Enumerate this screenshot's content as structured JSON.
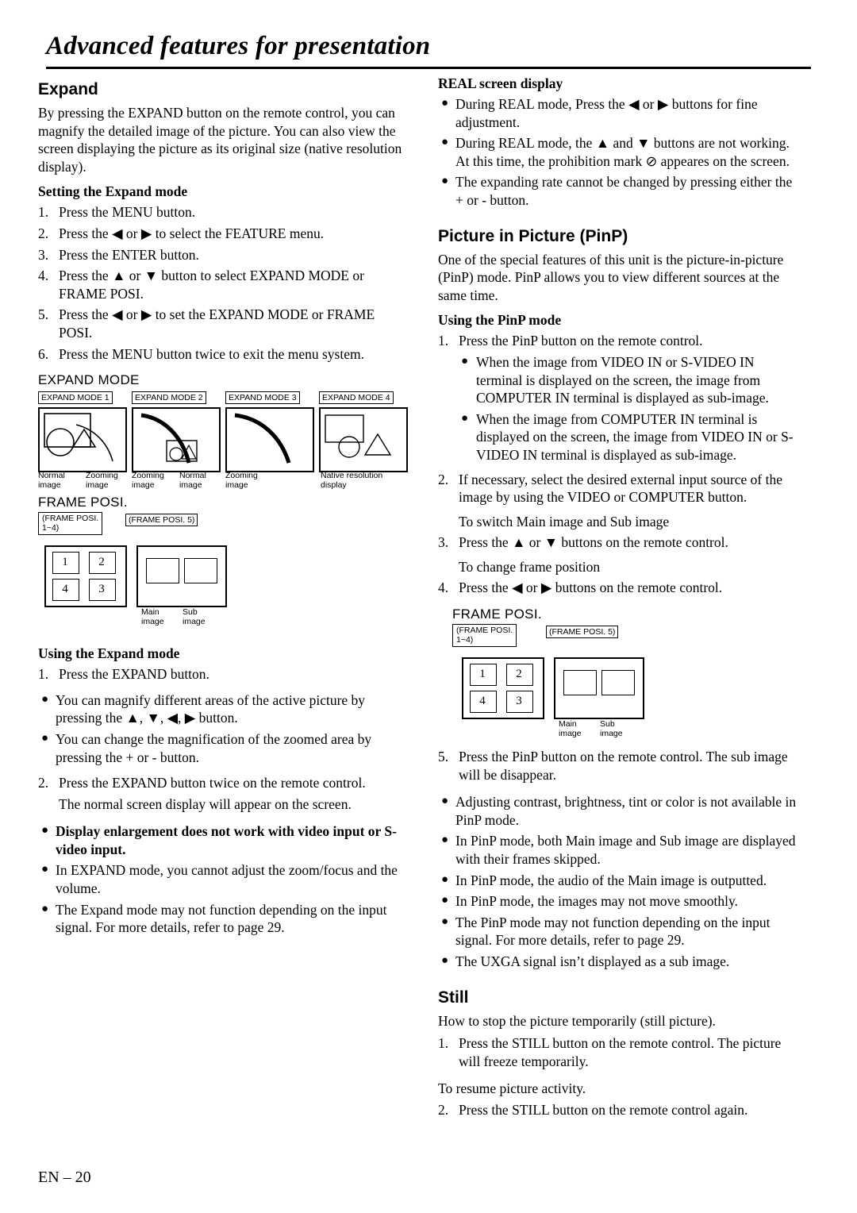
{
  "page": {
    "title": "Advanced features for presentation",
    "footer": "EN – 20"
  },
  "left": {
    "expand": {
      "heading": "Expand",
      "intro": "By pressing the EXPAND button on the remote control, you can magnify the detailed image of the picture. You can also view the screen displaying the picture as its original size (native resolution display).",
      "setting_heading": "Setting the Expand mode",
      "steps": [
        {
          "num": "1.",
          "text": "Press the MENU button."
        },
        {
          "num": "2.",
          "text": "Press the ◀ or ▶ to select the FEATURE menu."
        },
        {
          "num": "3.",
          "text": "Press the ENTER button."
        },
        {
          "num": "4.",
          "text": "Press the ▲ or ▼ button to select EXPAND MODE or FRAME POSI."
        },
        {
          "num": "5.",
          "text": "Press the ◀ or ▶ to set the EXPAND MODE or FRAME POSI."
        },
        {
          "num": "6.",
          "text": "Press the MENU button twice to exit the menu system."
        }
      ],
      "expand_mode_label": "EXPAND MODE",
      "expand_mode_cells": [
        {
          "label": "EXPAND MODE 1",
          "caption_left": "Normal\nimage",
          "caption_right": "Zooming\nimage"
        },
        {
          "label": "EXPAND MODE 2",
          "caption_left": "Zooming\nimage",
          "caption_right": "Normal\nimage"
        },
        {
          "label": "EXPAND MODE 3",
          "caption_left": "Zooming\nimage",
          "caption_right": ""
        },
        {
          "label": "EXPAND MODE 4",
          "caption_left": "Native resolution\ndisplay",
          "caption_right": ""
        }
      ],
      "frame_posi_label": "FRAME POSI.",
      "frame_posi_box1": "FRAME POSI.\n1~4)",
      "frame_posi_box1_open": "(FRAME POSI.",
      "frame_posi_box1_range": "1~4)",
      "frame_posi_box2": "(FRAME POSI. 5)",
      "frame_quadrants": [
        "1",
        "2",
        "4",
        "3"
      ],
      "main_caption": "Main\nimage",
      "sub_caption": "Sub\nimage",
      "using_heading": "Using the Expand mode",
      "using_steps": [
        {
          "type": "num",
          "num": "1.",
          "text": "Press the EXPAND button."
        },
        {
          "type": "bullet",
          "text": "You can magnify different areas of the active picture by pressing the ▲, ▼, ◀, ▶ button."
        },
        {
          "type": "bullet",
          "text": "You can change the magnification of the zoomed area by pressing the + or - button."
        },
        {
          "type": "num",
          "num": "2.",
          "text": "Press the EXPAND button twice on the remote control."
        },
        {
          "type": "plain",
          "text": "The normal screen display will appear on the screen."
        }
      ],
      "notes": [
        {
          "bold": true,
          "text": "Display enlargement does not work with video input or S-video input."
        },
        {
          "bold": false,
          "text": "In EXPAND mode, you cannot adjust the zoom/focus and the volume."
        },
        {
          "bold": false,
          "text": "The Expand mode may not function depending on the input signal. For more details, refer to page 29."
        }
      ]
    }
  },
  "right": {
    "real": {
      "heading": "REAL screen display",
      "bullets": [
        "During REAL mode, Press the ◀ or ▶ buttons for fine adjustment.",
        "During REAL mode, the ▲ and ▼ buttons are not working. At this time, the prohibition mark ⊘ appeares on the screen.",
        "The expanding rate cannot be changed by pressing either the + or - button."
      ]
    },
    "pinp": {
      "heading": "Picture in Picture (PinP)",
      "intro": "One of the special features of this unit is the picture-in-picture (PinP) mode. PinP allows you to view different sources at the same time.",
      "using_heading": "Using the PinP mode",
      "items": [
        {
          "type": "num",
          "num": "1.",
          "text": "Press the PinP button on the remote control."
        },
        {
          "type": "subbullet",
          "text": "When the image from VIDEO IN or S-VIDEO IN terminal is displayed on the screen, the image from COMPUTER IN terminal is displayed as sub-image."
        },
        {
          "type": "subbullet",
          "text": "When the image from COMPUTER IN terminal is displayed on the screen, the image from VIDEO IN or S-VIDEO IN terminal is displayed as sub-image."
        },
        {
          "type": "num",
          "num": "2.",
          "text": "If necessary, select the desired external input source of the image by using the VIDEO or COMPUTER button."
        },
        {
          "type": "plain",
          "text": "To switch Main image and Sub image"
        },
        {
          "type": "num",
          "num": "3.",
          "text": "Press the ▲ or ▼ buttons on the remote control."
        },
        {
          "type": "plain",
          "text": "To change frame position"
        },
        {
          "type": "num",
          "num": "4.",
          "text": "Press the ◀ or ▶ buttons on the remote control."
        }
      ],
      "frame_posi_label": "FRAME POSI.",
      "frame_posi_box1_open": "(FRAME POSI.",
      "frame_posi_box1_range": "1~4)",
      "frame_posi_box2": "(FRAME POSI. 5)",
      "frame_quadrants": [
        "1",
        "2",
        "4",
        "3"
      ],
      "main_caption": "Main\nimage",
      "sub_caption": "Sub\nimage",
      "after_items": [
        {
          "type": "num",
          "num": "5.",
          "text": "Press the PinP button on the remote control. The sub image will be disappear."
        }
      ],
      "notes": [
        "Adjusting contrast, brightness, tint or color is not available in PinP mode.",
        "In PinP mode, both Main image and Sub image are displayed with their frames skipped.",
        "In PinP mode, the audio of the Main image is outputted.",
        "In PinP mode, the images may not move smoothly.",
        "The PinP mode may not function depending on the input signal. For more details, refer to page 29.",
        "The UXGA signal isn’t displayed as a sub image."
      ]
    },
    "still": {
      "heading": "Still",
      "intro": "How to stop the picture temporarily (still picture).",
      "steps": [
        {
          "num": "1.",
          "text": "Press the STILL button on the remote control. The picture will freeze temporarily."
        }
      ],
      "resume_text": "To resume picture activity.",
      "resume_steps": [
        {
          "num": "2.",
          "text": "Press the STILL button on the remote control again."
        }
      ]
    }
  }
}
